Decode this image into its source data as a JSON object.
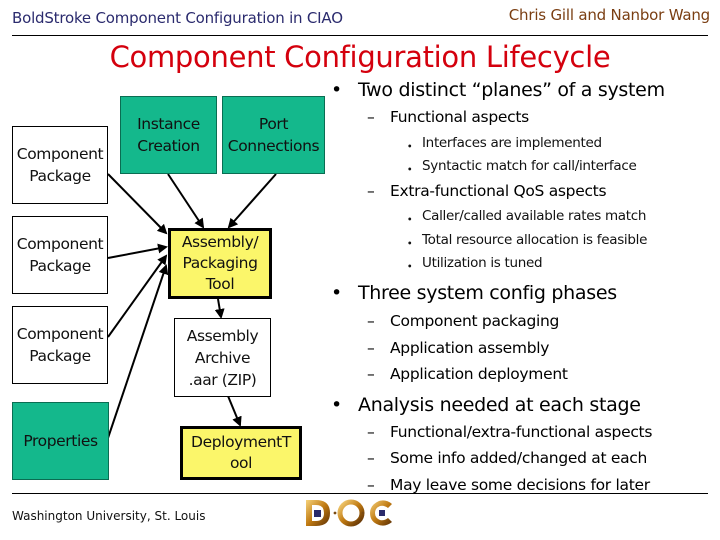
{
  "header": {
    "title": "BoldStroke Component Configuration in CIAO",
    "author": "Chris Gill and Nanbor Wang"
  },
  "slide": {
    "title": "Component Configuration Lifecycle"
  },
  "diagram": {
    "nodes": {
      "component_package_1": "Component Package",
      "component_package_2": "Component Package",
      "component_package_3": "Component Package",
      "properties": "Properties",
      "instance_creation": "Instance Creation",
      "port_connections": "Port Connections",
      "assembly_tool": "Assembly/ Packaging Tool",
      "assembly_archive": "Assembly Archive .aar (ZIP)",
      "deployment_tool": "DeploymentT ool"
    },
    "edges": [
      {
        "from": "component_package_1",
        "to": "assembly_tool"
      },
      {
        "from": "component_package_2",
        "to": "assembly_tool"
      },
      {
        "from": "component_package_3",
        "to": "assembly_tool"
      },
      {
        "from": "properties",
        "to": "assembly_tool"
      },
      {
        "from": "instance_creation",
        "to": "assembly_tool"
      },
      {
        "from": "port_connections",
        "to": "assembly_tool"
      },
      {
        "from": "assembly_tool",
        "to": "assembly_archive"
      },
      {
        "from": "assembly_archive",
        "to": "deployment_tool"
      }
    ],
    "colors": {
      "teal": "#14b88c",
      "yellow": "#fbf66a",
      "title_red": "#d4000d"
    }
  },
  "bullets": {
    "b1": {
      "text": "Two distinct “planes” of a system",
      "sub1": {
        "text": "Functional aspects",
        "items": [
          "Interfaces are implemented",
          "Syntactic match for call/interface"
        ]
      },
      "sub2": {
        "text": "Extra-functional QoS aspects",
        "items": [
          "Caller/called available rates match",
          "Total resource allocation is feasible",
          "Utilization is tuned"
        ]
      }
    },
    "b2": {
      "text": "Three system config phases",
      "items": [
        "Component packaging",
        "Application assembly",
        "Application deployment"
      ]
    },
    "b3": {
      "text": "Analysis needed at each stage",
      "items": [
        "Functional/extra-functional aspects",
        "Some info added/changed at each",
        "May leave some decisions for later"
      ]
    },
    "marks": {
      "bullet": "•",
      "dash": "–",
      "small_bullet": "・"
    }
  },
  "footer": {
    "institution": "Washington University, St. Louis",
    "logo": "DOC Group logo"
  }
}
